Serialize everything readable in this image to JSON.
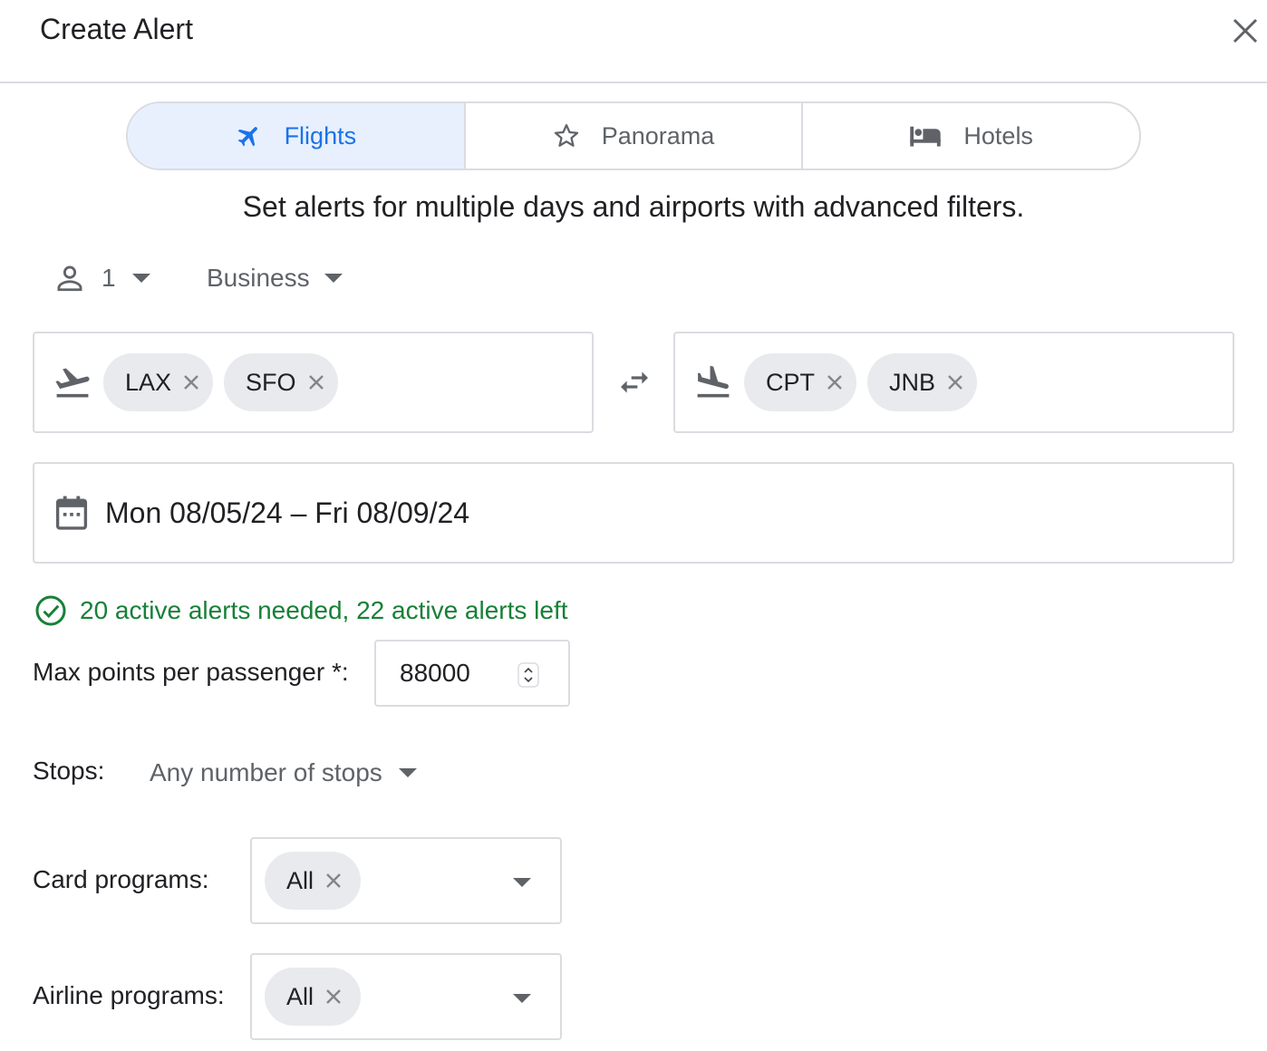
{
  "dialog": {
    "title": "Create Alert"
  },
  "tabs": [
    {
      "label": "Flights",
      "icon": "airplane-icon",
      "active": true
    },
    {
      "label": "Panorama",
      "icon": "star-icon",
      "active": false
    },
    {
      "label": "Hotels",
      "icon": "bed-icon",
      "active": false
    }
  ],
  "subtitle": "Set alerts for multiple days and airports with advanced filters.",
  "passengers": {
    "value": "1",
    "icon": "person-icon"
  },
  "cabin": {
    "value": "Business"
  },
  "origin": {
    "icon": "takeoff-icon",
    "airports": [
      "LAX",
      "SFO"
    ]
  },
  "destination": {
    "icon": "landing-icon",
    "airports": [
      "CPT",
      "JNB"
    ]
  },
  "date_range": {
    "icon": "calendar-icon",
    "value": "Mon 08/05/24 – Fri 08/09/24"
  },
  "status": {
    "icon": "check-circle-icon",
    "text": "20 active alerts needed, 22 active alerts left",
    "color": "#188038"
  },
  "max_points": {
    "label": "Max points per passenger *:",
    "value": "88000"
  },
  "stops": {
    "label": "Stops:",
    "value": "Any number of stops"
  },
  "card_programs": {
    "label": "Card programs:",
    "chips": [
      "All"
    ]
  },
  "airline_programs": {
    "label": "Airline programs:",
    "chips": [
      "All"
    ]
  },
  "colors": {
    "accent": "#1a73e8",
    "active_tab_bg": "#e8f0fe",
    "chip_bg": "#e8eaed",
    "border": "#dadce0"
  }
}
